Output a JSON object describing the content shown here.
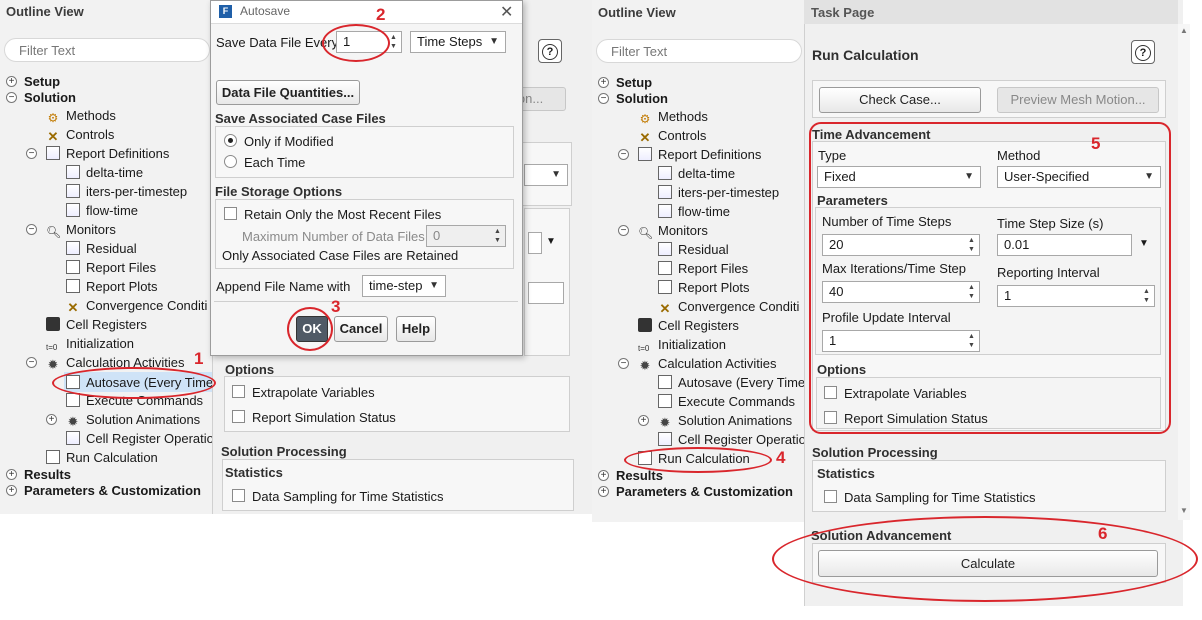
{
  "left_outline": {
    "title": "Outline View",
    "filter_placeholder": "Filter Text",
    "items": {
      "setup": "Setup",
      "solution": "Solution",
      "methods": "Methods",
      "controls": "Controls",
      "report_definitions": "Report Definitions",
      "delta_time": "delta-time",
      "iters_per_timestep": "iters-per-timestep",
      "flow_time": "flow-time",
      "monitors": "Monitors",
      "residual": "Residual",
      "report_files": "Report Files",
      "report_plots": "Report Plots",
      "convergence": "Convergence Conditi",
      "cell_registers": "Cell Registers",
      "initialization": "Initialization",
      "calculation_activities": "Calculation Activities",
      "autosave": "Autosave (Every Time",
      "execute_commands": "Execute Commands",
      "solution_animations": "Solution Animations",
      "cell_register_ops": "Cell Register Operatio",
      "run_calculation": "Run Calculation",
      "results": "Results",
      "parameters": "Parameters & Customization"
    }
  },
  "autosave_dialog": {
    "title": "Autosave",
    "save_every_label": "Save Data File Every",
    "save_every_value": "1",
    "units": "Time Steps",
    "quantities_button": "Data File Quantities...",
    "assoc_section": "Save Associated Case Files",
    "only_if_modified": "Only if Modified",
    "each_time": "Each Time",
    "storage_section": "File Storage Options",
    "retain_recent": "Retain Only the Most Recent Files",
    "max_files_label": "Maximum Number of Data Files",
    "max_files_value": "0",
    "assoc_retained": "Only Associated Case Files are Retained",
    "append_label": "Append File Name with",
    "append_value": "time-step",
    "ok": "OK",
    "cancel": "Cancel",
    "help": "Help"
  },
  "left_task_partial": {
    "preview_partial": "ion...",
    "options": "Options",
    "extrapolate": "Extrapolate Variables",
    "report_status": "Report Simulation Status",
    "solution_processing": "Solution Processing",
    "statistics": "Statistics",
    "data_sampling": "Data Sampling for Time Statistics"
  },
  "right_outline": {
    "title": "Outline View",
    "filter_placeholder": "Filter Text",
    "items": {
      "setup": "Setup",
      "solution": "Solution",
      "methods": "Methods",
      "controls": "Controls",
      "report_definitions": "Report Definitions",
      "delta_time": "delta-time",
      "iters_per_timestep": "iters-per-timestep",
      "flow_time": "flow-time",
      "monitors": "Monitors",
      "residual": "Residual",
      "report_files": "Report Files",
      "report_plots": "Report Plots",
      "convergence": "Convergence Conditi",
      "cell_registers": "Cell Registers",
      "initialization": "Initialization",
      "calculation_activities": "Calculation Activities",
      "autosave": "Autosave (Every Time",
      "execute_commands": "Execute Commands",
      "solution_animations": "Solution Animations",
      "cell_register_ops": "Cell Register Operatio",
      "run_calculation": "Run Calculation",
      "results": "Results",
      "parameters": "Parameters & Customization"
    }
  },
  "task_page": {
    "header": "Task Page",
    "title": "Run Calculation",
    "check_case": "Check Case...",
    "preview_mesh": "Preview Mesh Motion...",
    "time_advancement": "Time Advancement",
    "type_label": "Type",
    "type_value": "Fixed",
    "method_label": "Method",
    "method_value": "User-Specified",
    "parameters": "Parameters",
    "num_steps_label": "Number of Time Steps",
    "num_steps_value": "20",
    "step_size_label": "Time Step Size (s)",
    "step_size_value": "0.01",
    "max_iter_label": "Max Iterations/Time Step",
    "max_iter_value": "40",
    "reporting_label": "Reporting Interval",
    "reporting_value": "1",
    "profile_label": "Profile Update Interval",
    "profile_value": "1",
    "options": "Options",
    "extrapolate": "Extrapolate Variables",
    "report_status": "Report Simulation Status",
    "solution_processing": "Solution Processing",
    "statistics": "Statistics",
    "data_sampling": "Data Sampling for Time Statistics",
    "solution_advancement": "Solution Advancement",
    "calculate": "Calculate"
  },
  "annotations": {
    "n1": "1",
    "n2": "2",
    "n3": "3",
    "n4": "4",
    "n5": "5",
    "n6": "6"
  },
  "colors": {
    "annotation_red": "#d9262c",
    "panel_bg": "#f2f2f2",
    "selection": "#cfe3f7"
  }
}
